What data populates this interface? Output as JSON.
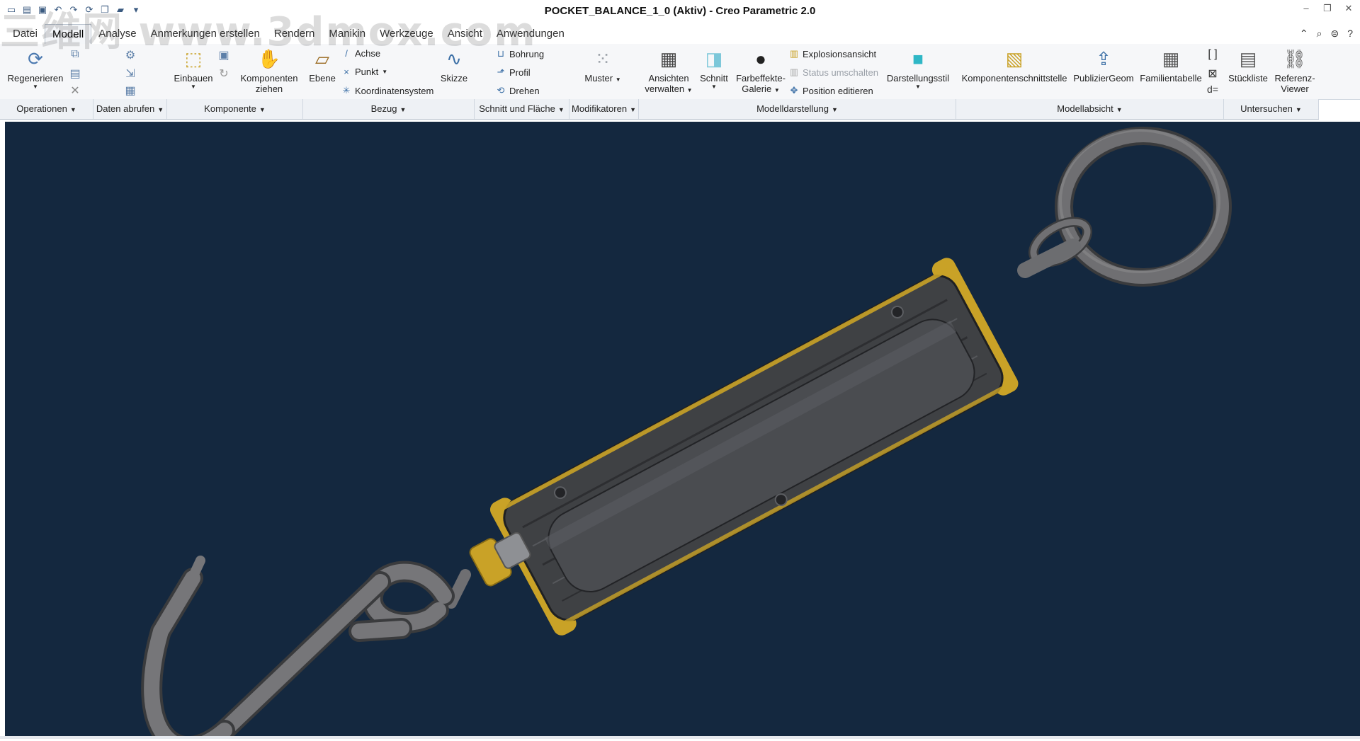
{
  "window": {
    "title": "POCKET_BALANCE_1_0 (Aktiv) - Creo Parametric 2.0"
  },
  "watermark": "三维网  www.3dmox.com",
  "tabs": [
    "Datei",
    "Modell",
    "Analyse",
    "Anmerkungen erstellen",
    "Rendern",
    "Manikin",
    "Werkzeuge",
    "Ansicht",
    "Anwendungen"
  ],
  "active_tab": "Modell",
  "ribbon": {
    "regenerieren": "Regenerieren",
    "einbauen": "Einbauen",
    "komponenten_ziehen_1": "Komponenten",
    "komponenten_ziehen_2": "ziehen",
    "ebene": "Ebene",
    "achse": "Achse",
    "punkt": "Punkt",
    "koordinatensystem": "Koordinatensystem",
    "skizze": "Skizze",
    "bohrung": "Bohrung",
    "profil": "Profil",
    "drehen": "Drehen",
    "muster": "Muster",
    "ansichten_1": "Ansichten",
    "ansichten_2": "verwalten",
    "schnitt": "Schnitt",
    "farbeffekte_1": "Farbeffekte-",
    "farbeffekte_2": "Galerie",
    "explosionsansicht": "Explosionsansicht",
    "status_umschalten": "Status umschalten",
    "position_editieren": "Position editieren",
    "darstellungsstil": "Darstellungsstil",
    "komponentenschnittstelle": "Komponentenschnittstelle",
    "publiziergeom": "PublizierGeom",
    "familientabelle": "Familientabelle",
    "stueckliste": "Stückliste",
    "referenz_1": "Referenz-",
    "referenz_2": "Viewer"
  },
  "groups": [
    "Operationen",
    "Daten abrufen",
    "Komponente",
    "Bezug",
    "Schnitt und Fläche",
    "Modifikatoren",
    "Modelldarstellung",
    "Modellabsicht",
    "Untersuchen"
  ],
  "colors": {
    "viewport_bg": "#14283f",
    "body_gray": "#3f4144",
    "accent_yellow": "#c9a227",
    "hook_gray": "#6f6f72"
  }
}
